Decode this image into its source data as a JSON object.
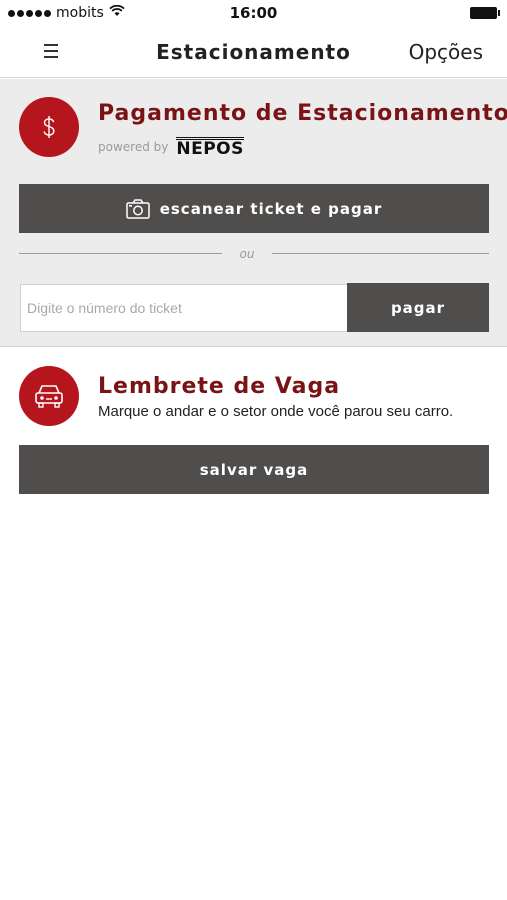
{
  "status_bar": {
    "carrier": "mobits",
    "time": "16:00"
  },
  "nav": {
    "title": "Estacionamento",
    "right_button": "Opções",
    "menu_icon": "hamburger-icon"
  },
  "payment": {
    "icon": "dollar-icon",
    "title": "Pagamento de Estacionamento",
    "powered_by": "powered by",
    "provider": "NEPOS",
    "scan_button": "escanear ticket e pagar",
    "scan_icon": "camera-icon",
    "divider_text": "ou",
    "ticket_placeholder": "Digite o número do ticket",
    "ticket_value": "",
    "pay_button": "pagar"
  },
  "reminder": {
    "icon": "car-icon",
    "title": "Lembrete de Vaga",
    "description": "Marque o andar e o setor onde você parou seu carro.",
    "save_button": "salvar vaga"
  },
  "colors": {
    "accent": "#b5151c",
    "title": "#7a1316",
    "button": "#504e4d",
    "panel": "#ececec"
  }
}
